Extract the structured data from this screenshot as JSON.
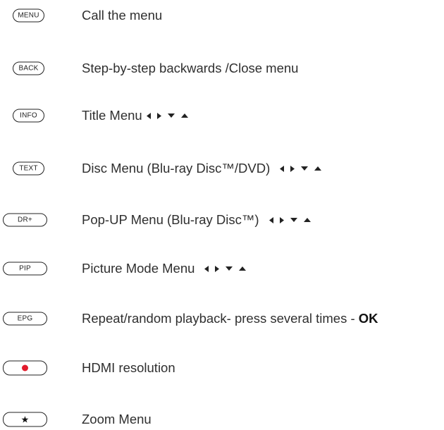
{
  "rows": [
    {
      "button": "MENU",
      "text": "Call the menu"
    },
    {
      "button": "BACK",
      "text": "Step-by-step backwards /Close menu"
    },
    {
      "button": "INFO",
      "text": "Title Menu"
    },
    {
      "button": "TEXT",
      "text": "Disc Menu (Blu-ray Disc™/DVD)"
    },
    {
      "button": "DR+",
      "text": "Pop-UP Menu (Blu-ray Disc™)"
    },
    {
      "button": "PIP",
      "text": "Picture Mode Menu"
    },
    {
      "button": "EPG",
      "text": "Repeat/random playback- press several times - ",
      "bold": "OK"
    },
    {
      "button_icon": "record-dot-icon",
      "text": "HDMI resolution"
    },
    {
      "button_icon": "star-icon",
      "text": "Zoom Menu"
    }
  ],
  "colors": {
    "text": "#2f2f2f",
    "record_dot": "#e21b2c"
  },
  "icons": {
    "arrows": [
      "arrow-left-icon",
      "arrow-right-icon",
      "arrow-down-icon",
      "arrow-up-icon"
    ]
  }
}
